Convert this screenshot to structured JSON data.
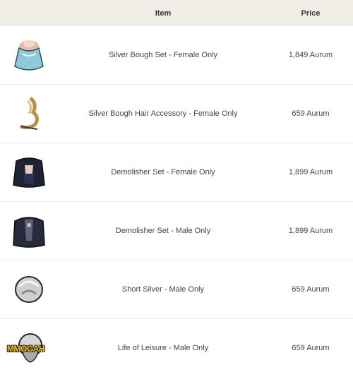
{
  "table": {
    "headers": {
      "item": "Item",
      "price": "Price"
    },
    "rows": [
      {
        "icon": "dress-icon",
        "name": "Silver Bough Set - Female Only",
        "price": "1,849 Aurum"
      },
      {
        "icon": "hair-accessory-icon",
        "name": "Silver Bough Hair Accessory - Female Only",
        "price": "659 Aurum"
      },
      {
        "icon": "dark-outfit-icon",
        "name": "Demolisher Set - Female Only",
        "price": "1,899 Aurum"
      },
      {
        "icon": "dark-coat-icon",
        "name": "Demolisher Set - Male Only",
        "price": "1,899 Aurum"
      },
      {
        "icon": "hair-icon",
        "name": "Short Silver - Male Only",
        "price": "659 Aurum"
      },
      {
        "icon": "hair-long-icon",
        "name": "Life of Leisure - Male Only",
        "price": "659 Aurum"
      }
    ]
  },
  "watermark": "MMOGAH",
  "colors": {
    "header_bg": "#f0ede6",
    "row_border": "#ececec",
    "watermark": "#f5c518"
  }
}
